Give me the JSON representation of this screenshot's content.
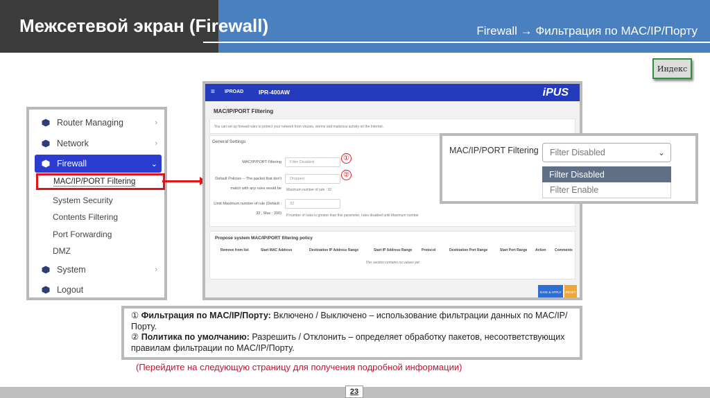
{
  "header": {
    "title": "Межсетевой экран (Firewall)",
    "subtitle": "Firewall → Фильтрация по MAC/IP/Порту"
  },
  "index_button": {
    "label": "Индекс"
  },
  "sidebar": {
    "items": [
      {
        "label": "Router Managing",
        "chevron": "›"
      },
      {
        "label": "Network",
        "chevron": "›"
      },
      {
        "label": "Firewall",
        "chevron": "⌄"
      },
      {
        "label": "System",
        "chevron": "›"
      },
      {
        "label": "Logout"
      }
    ],
    "subitems": [
      {
        "label": "MAC/IP/PORT Filtering"
      },
      {
        "label": "System Security"
      },
      {
        "label": "Contents Filtering"
      },
      {
        "label": "Port Forwarding"
      },
      {
        "label": "DMZ"
      }
    ]
  },
  "router_ui": {
    "menu_icon": "≡",
    "brand": "IPROAD",
    "model": "IPR-400AW",
    "logo": "iPUS",
    "page_title": "MAC/IP/PORT Filtering",
    "intro": "You can set up firewall rules to protect your network from viruses, worms and malicious activity on the Internet.",
    "general_settings": "General Settings",
    "filter_label": "MAC/IP/PORT Filtering",
    "filter_value": "Filter Disabled",
    "policy_label_1": "Default Policies -- The packet that don't",
    "policy_label_2": "match with any rules would be",
    "policy_value": "Dropped",
    "policy_hint": "Maximum number of rule : 32",
    "limit_label_1": "Limit Maximum number of rule (Default :",
    "limit_label_2": "32 , Max : 200)",
    "limit_value": "32",
    "limit_hint": "If number of rules is greater than this parameter, rules disabled until Maximum number",
    "table_title": "Propose system MAC/IP/PORT filtering policy",
    "columns": [
      "Remove from list",
      "Start MAC Address",
      "Destination IP Address Range",
      "Start IP Address Range",
      "Protocol",
      "Destination Port Range",
      "Start Port Range",
      "Action",
      "Comments"
    ],
    "empty_text": "This section contains no values yet",
    "save_btn": "SAVE & APPLY",
    "reset_btn": "RESET",
    "marker_1": "①",
    "marker_2": "②"
  },
  "dropdown_zoom": {
    "label": "MAC/IP/PORT Filtering",
    "selected": "Filter Disabled",
    "caret": "⌄",
    "options": [
      "Filter Disabled",
      "Filter Enable"
    ]
  },
  "description": {
    "line1_num": "①",
    "line1_bold": "Фильтрация по MAC/IP/Порту:",
    "line1_text": " Включено / Выключено – использование фильтрации данных по MAC/IP/Порту.",
    "line2_num": "②",
    "line2_bold": "Политика по умолчанию:",
    "line2_text": " Разрешить / Отклонить – определяет обработку пакетов, несоответствующих правилам фильтрации по MAC/IP/Порту."
  },
  "note": "(Перейдите на следующую страницу для получения подробной информации)",
  "footer": {
    "page_number": "23"
  },
  "colors": {
    "accent": "#2c3bd0",
    "highlight": "#e0141b",
    "header_blue": "#4a7fc0",
    "header_dark": "#3b3b3b"
  }
}
